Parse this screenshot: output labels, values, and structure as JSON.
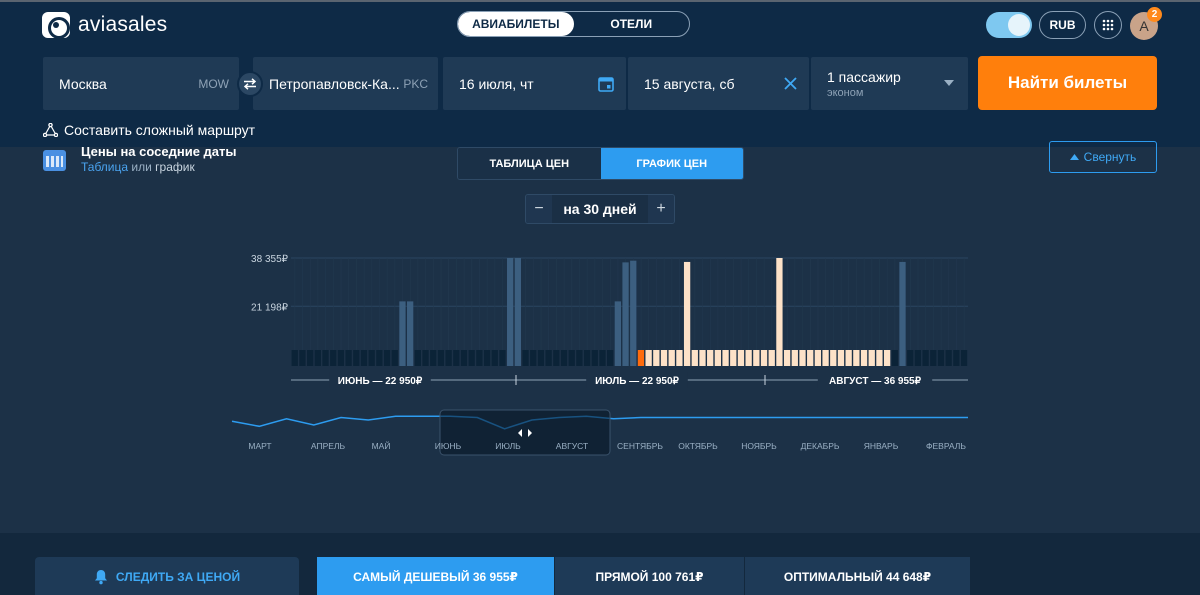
{
  "brand": {
    "name": "aviasales"
  },
  "top_tabs": [
    {
      "label": "АВИАБИЛЕТЫ",
      "active": true
    },
    {
      "label": "ОТЕЛИ",
      "active": false
    }
  ],
  "header_right": {
    "currency": "RUB",
    "avatar_letter": "A",
    "notifications": "2"
  },
  "search": {
    "origin": {
      "city": "Москва",
      "code": "MOW"
    },
    "destination": {
      "city": "Петропавловск-Ка...",
      "code": "PKC"
    },
    "depart_date": "16 июля, чт",
    "return_date": "15 августа, сб",
    "passengers": "1 пассажир",
    "cabin": "эконом",
    "find_button": "Найти билеты"
  },
  "complex_route": "Составить сложный маршрут",
  "nearby": {
    "title": "Цены на соседние даты",
    "subtitle_link": "Таблица",
    "subtitle_or": "или",
    "subtitle_bold": "график"
  },
  "view_tabs": [
    {
      "label": "ТАБЛИЦА ЦЕН",
      "active": false
    },
    {
      "label": "ГРАФИК ЦЕН",
      "active": true
    }
  ],
  "collapse_label": "Свернуть",
  "range": {
    "minus": "−",
    "value": "на 30 дней",
    "plus": "+"
  },
  "colors": {
    "bar_dark": "#0b2337",
    "bar_blue": "#3c5f80",
    "bar_selected": "#ff6b0c",
    "bar_range": "#fde2c8",
    "accent": "#2d9cf0",
    "orange": "#ff7f0c"
  },
  "chart_data": {
    "type": "bar",
    "y_ticks": [
      "38 355₽",
      "21 198₽"
    ],
    "y_tick_values": [
      38355,
      21198
    ],
    "month_labels": [
      "ИЮНЬ — 22 950₽",
      "ИЮЛЬ — 22 950₽",
      "АВГУСТ — 36 955₽"
    ],
    "bars": [
      {
        "v": 0,
        "s": "empty"
      },
      {
        "v": 0,
        "s": "empty"
      },
      {
        "v": 0,
        "s": "empty"
      },
      {
        "v": 0,
        "s": "empty"
      },
      {
        "v": 0,
        "s": "empty"
      },
      {
        "v": 0,
        "s": "empty"
      },
      {
        "v": 0,
        "s": "empty"
      },
      {
        "v": 0,
        "s": "empty"
      },
      {
        "v": 0,
        "s": "empty"
      },
      {
        "v": 0,
        "s": "empty"
      },
      {
        "v": 0,
        "s": "empty"
      },
      {
        "v": 0,
        "s": "empty"
      },
      {
        "v": 0,
        "s": "empty"
      },
      {
        "v": 0,
        "s": "empty"
      },
      {
        "v": 22950,
        "s": "price"
      },
      {
        "v": 22950,
        "s": "price"
      },
      {
        "v": 0,
        "s": "empty"
      },
      {
        "v": 0,
        "s": "empty"
      },
      {
        "v": 0,
        "s": "empty"
      },
      {
        "v": 0,
        "s": "empty"
      },
      {
        "v": 0,
        "s": "empty"
      },
      {
        "v": 0,
        "s": "empty"
      },
      {
        "v": 0,
        "s": "empty"
      },
      {
        "v": 0,
        "s": "empty"
      },
      {
        "v": 0,
        "s": "empty"
      },
      {
        "v": 0,
        "s": "empty"
      },
      {
        "v": 0,
        "s": "empty"
      },
      {
        "v": 0,
        "s": "empty"
      },
      {
        "v": 38355,
        "s": "price"
      },
      {
        "v": 38355,
        "s": "price"
      },
      {
        "v": 0,
        "s": "empty"
      },
      {
        "v": 0,
        "s": "empty"
      },
      {
        "v": 0,
        "s": "empty"
      },
      {
        "v": 0,
        "s": "empty"
      },
      {
        "v": 0,
        "s": "empty"
      },
      {
        "v": 0,
        "s": "empty"
      },
      {
        "v": 0,
        "s": "empty"
      },
      {
        "v": 0,
        "s": "empty"
      },
      {
        "v": 0,
        "s": "empty"
      },
      {
        "v": 0,
        "s": "empty"
      },
      {
        "v": 0,
        "s": "empty"
      },
      {
        "v": 0,
        "s": "empty"
      },
      {
        "v": 22950,
        "s": "price"
      },
      {
        "v": 36800,
        "s": "price"
      },
      {
        "v": 37400,
        "s": "price"
      },
      {
        "v": 0,
        "s": "selected"
      },
      {
        "v": 0,
        "s": "range"
      },
      {
        "v": 0,
        "s": "range"
      },
      {
        "v": 0,
        "s": "range"
      },
      {
        "v": 0,
        "s": "range"
      },
      {
        "v": 0,
        "s": "range"
      },
      {
        "v": 36955,
        "s": "range"
      },
      {
        "v": 0,
        "s": "range"
      },
      {
        "v": 0,
        "s": "range"
      },
      {
        "v": 0,
        "s": "range"
      },
      {
        "v": 0,
        "s": "range"
      },
      {
        "v": 0,
        "s": "range"
      },
      {
        "v": 0,
        "s": "range"
      },
      {
        "v": 0,
        "s": "range"
      },
      {
        "v": 0,
        "s": "range"
      },
      {
        "v": 0,
        "s": "range"
      },
      {
        "v": 0,
        "s": "range"
      },
      {
        "v": 0,
        "s": "range"
      },
      {
        "v": 38355,
        "s": "range"
      },
      {
        "v": 0,
        "s": "range"
      },
      {
        "v": 0,
        "s": "range"
      },
      {
        "v": 0,
        "s": "range"
      },
      {
        "v": 0,
        "s": "range"
      },
      {
        "v": 0,
        "s": "range"
      },
      {
        "v": 0,
        "s": "range"
      },
      {
        "v": 0,
        "s": "range"
      },
      {
        "v": 0,
        "s": "range"
      },
      {
        "v": 0,
        "s": "range"
      },
      {
        "v": 0,
        "s": "range"
      },
      {
        "v": 0,
        "s": "range"
      },
      {
        "v": 0,
        "s": "range"
      },
      {
        "v": 0,
        "s": "range"
      },
      {
        "v": 0,
        "s": "range"
      },
      {
        "v": 0,
        "s": "empty"
      },
      {
        "v": 36955,
        "s": "price"
      },
      {
        "v": 0,
        "s": "empty"
      },
      {
        "v": 0,
        "s": "empty"
      },
      {
        "v": 0,
        "s": "empty"
      },
      {
        "v": 0,
        "s": "empty"
      },
      {
        "v": 0,
        "s": "empty"
      },
      {
        "v": 0,
        "s": "empty"
      },
      {
        "v": 0,
        "s": "empty"
      },
      {
        "v": 0,
        "s": "empty"
      }
    ],
    "timeline_months": [
      "МАРТ",
      "АПРЕЛЬ",
      "МАЙ",
      "ИЮНЬ",
      "ИЮЛЬ",
      "АВГУСТ",
      "СЕНТЯБРЬ",
      "ОКТЯБРЬ",
      "НОЯБРЬ",
      "ДЕКАБРЬ",
      "ЯНВАРЬ",
      "ФЕВРАЛЬ"
    ],
    "timeline_values": [
      0.55,
      0.35,
      0.65,
      0.4,
      0.7,
      0.6,
      0.75,
      0.75,
      0.75,
      0.7,
      0.25,
      0.6,
      0.7,
      0.75,
      0.65,
      0.7,
      0.7,
      0.7,
      0.7,
      0.7,
      0.7,
      0.7,
      0.7,
      0.7,
      0.7,
      0.7,
      0.7,
      0.7
    ]
  },
  "bottom": {
    "follow_label": "СЛЕДИТЬ ЗА ЦЕНОЙ",
    "sort_tabs": [
      {
        "label": "САМЫЙ ДЕШЕВЫЙ 36 955₽",
        "active": true
      },
      {
        "label": "ПРЯМОЙ 100 761₽",
        "active": false
      },
      {
        "label": "ОПТИМАЛЬНЫЙ 44 648₽",
        "active": false
      }
    ]
  }
}
